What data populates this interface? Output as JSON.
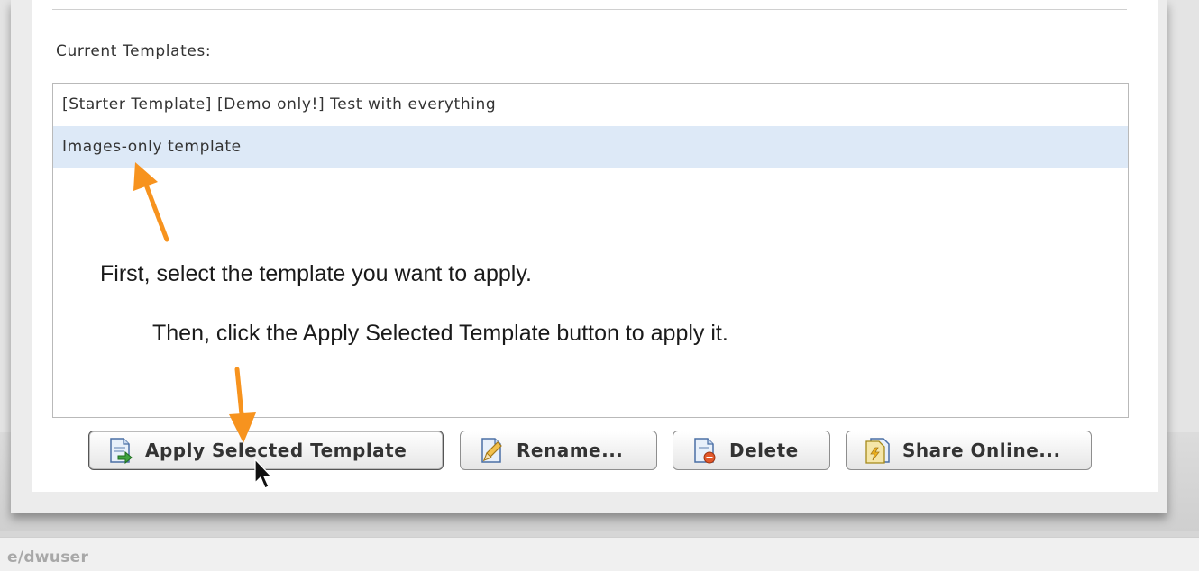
{
  "background": {
    "path_text": "e/dwuser"
  },
  "dialog": {
    "section_label": "Current Templates:",
    "templates": [
      {
        "label": "[Starter Template] [Demo only!] Test with everything",
        "selected": false
      },
      {
        "label": "Images-only template",
        "selected": true
      }
    ],
    "annotations": {
      "step1": "First, select the template you want to apply.",
      "step2": "Then, click the Apply Selected Template button to apply it."
    },
    "buttons": {
      "apply": "Apply Selected Template",
      "rename": "Rename...",
      "delete": "Delete",
      "share": "Share Online..."
    }
  },
  "colors": {
    "selection": "#dde9f7",
    "arrow": "#f7931e"
  },
  "icons": [
    "document-apply-icon",
    "document-rename-icon",
    "document-delete-icon",
    "document-share-icon",
    "mouse-cursor-icon",
    "annotation-arrow-icon"
  ]
}
